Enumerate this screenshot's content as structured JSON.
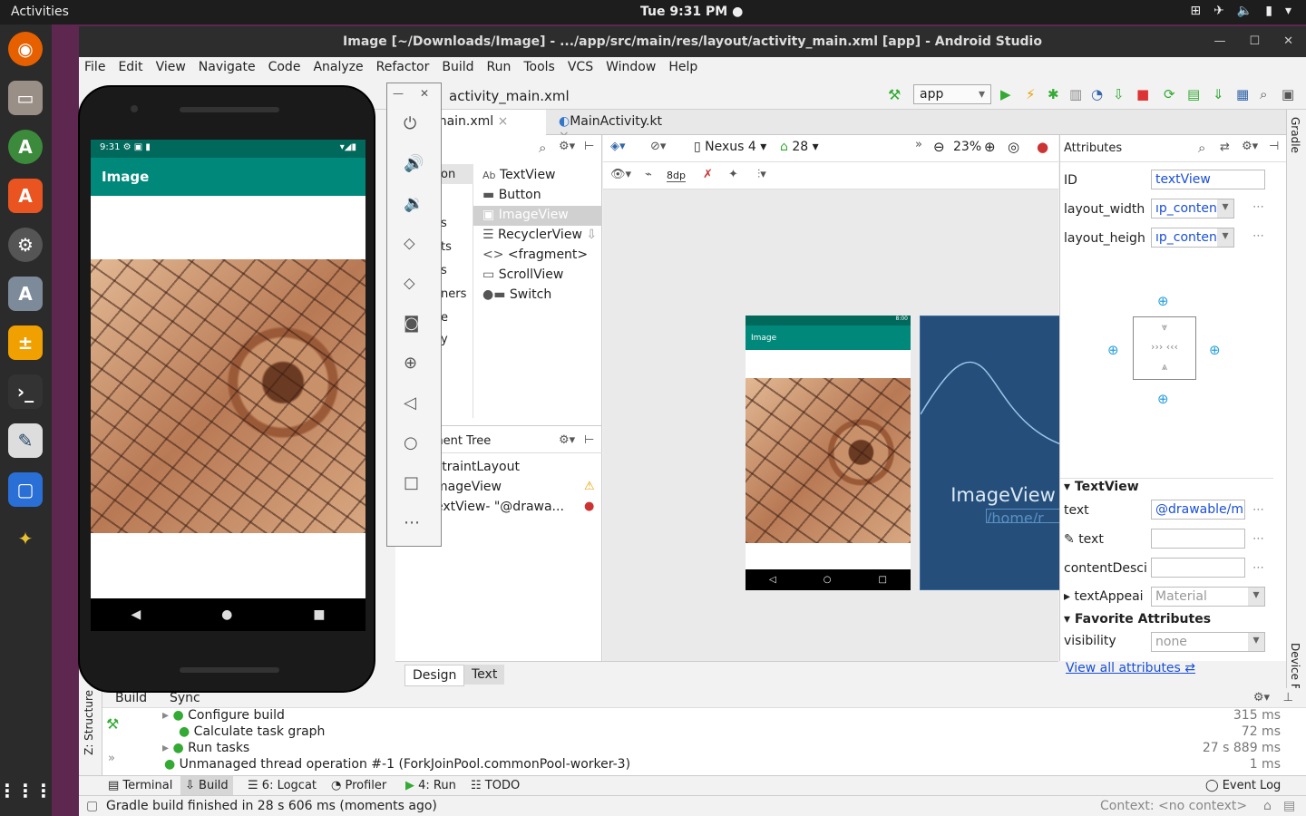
{
  "topbar": {
    "activities": "Activities",
    "clock": "Tue  9:31 PM ●"
  },
  "window": {
    "title": "Image [~/Downloads/Image] - .../app/src/main/res/layout/activity_main.xml [app] - Android Studio"
  },
  "menu": [
    "File",
    "Edit",
    "View",
    "Navigate",
    "Code",
    "Analyze",
    "Refactor",
    "Build",
    "Run",
    "Tools",
    "VCS",
    "Window",
    "Help"
  ],
  "breadcrumb": "activity_main.xml",
  "run_config": "app",
  "tabs": {
    "activity": "vity_main.xml",
    "main": "MainActivity.kt"
  },
  "palette": {
    "categories": [
      "on",
      "s",
      "ts",
      "s",
      "ners",
      "e",
      "y"
    ],
    "items": [
      "TextView",
      "Button",
      "ImageView",
      "RecyclerView",
      "<fragment>",
      "ScrollView",
      "Switch"
    ],
    "item_glyphs": [
      "Ab",
      "▬",
      "▣",
      "☰",
      "<>",
      "▭",
      "●▬"
    ]
  },
  "component_tree": {
    "header": "ment Tree",
    "items": [
      "straintLayout",
      "mageView",
      "extView- \"@drawa..."
    ]
  },
  "design_toolbar": {
    "device": "Nexus 4",
    "api": "28",
    "zoom": "23%",
    "margin": "8dp"
  },
  "preview": {
    "app_title": "Image",
    "status_time": "8:00",
    "blueprint_label": "ImageView",
    "blueprint_text": "/home/r"
  },
  "attributes": {
    "header": "Attributes",
    "id_label": "ID",
    "id_value": "textView",
    "width_label": "layout_width",
    "width_value": "ıp_content",
    "height_label": "layout_heigh",
    "height_value": "ıp_content",
    "textview_header": "TextView",
    "text_label": "text",
    "text_value": "@drawable/m",
    "text2_label": "text",
    "desc_label": "contentDesci",
    "appear_label": "textAppeai",
    "appear_value": "Material",
    "fav_header": "Favorite Attributes",
    "vis_label": "visibility",
    "vis_value": "none",
    "view_all": "View all attributes"
  },
  "bottom_tabs": {
    "design": "Design",
    "text": "Text"
  },
  "build": {
    "tabs": [
      "Build",
      "Sync"
    ],
    "rows": [
      {
        "label": "Configure build",
        "time": "315 ms"
      },
      {
        "label": "Calculate task graph",
        "time": "72 ms"
      },
      {
        "label": "Run tasks",
        "time": "27 s 889 ms"
      },
      {
        "label": "Unmanaged thread operation #-1 (ForkJoinPool.commonPool-worker-3)",
        "time": "1 ms"
      }
    ]
  },
  "tool_windows": [
    "Terminal",
    "Build",
    "6: Logcat",
    "Profiler",
    "4: Run",
    "TODO"
  ],
  "event_log": "Event Log",
  "status": {
    "message": "Gradle build finished in 28 s 606 ms (moments ago)",
    "context": "Context: <no context>"
  },
  "side": {
    "gradle": "Gradle",
    "structure": "Z: Structure",
    "device_explorer": "Device File Explorer"
  },
  "emulator": {
    "time": "9:31",
    "app_title": "Image"
  }
}
